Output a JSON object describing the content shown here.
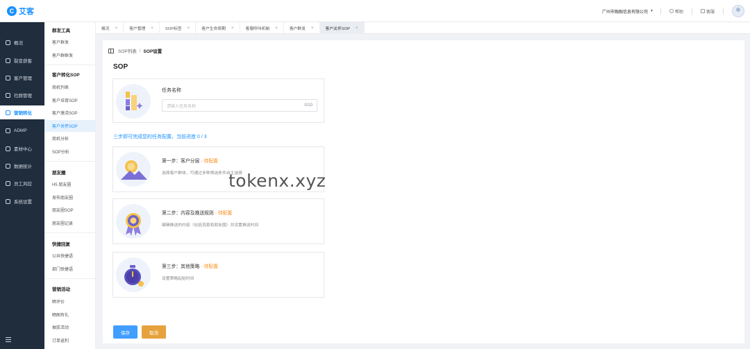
{
  "app": {
    "logo_mark": "C",
    "logo_text": "艾客"
  },
  "topbar": {
    "company": "广州市融融信息有限公司",
    "help": "帮助",
    "service": "客服"
  },
  "nav": {
    "items": [
      {
        "label": "概况",
        "icon": "home-icon"
      },
      {
        "label": "裂变获客",
        "icon": "user-icon"
      },
      {
        "label": "客户管理",
        "icon": "contacts-icon"
      },
      {
        "label": "社群管理",
        "icon": "group-icon"
      },
      {
        "label": "营销转化",
        "icon": "chart-icon",
        "active": true
      },
      {
        "label": "ADMP",
        "icon": "database-icon"
      },
      {
        "label": "素材中心",
        "icon": "folder-icon"
      },
      {
        "label": "数据统计",
        "icon": "stats-icon"
      },
      {
        "label": "员工风控",
        "icon": "shield-icon"
      },
      {
        "label": "系统设置",
        "icon": "gear-icon"
      }
    ]
  },
  "submenu": {
    "groups": [
      {
        "title": "群发工具",
        "items": [
          "客户群发",
          "客户群群发"
        ]
      },
      {
        "title": "客户转化SOP",
        "items": [
          "商机列表",
          "客户培育SOP",
          "客户激活SOP",
          "客户关怀SOP",
          "商机分析",
          "SOP分析"
        ]
      },
      {
        "title": "朋友圈",
        "items": [
          "H5 朋友圈",
          "发布朋友圈",
          "朋友圈SOP",
          "朋友圈记录"
        ]
      },
      {
        "title": "快捷回复",
        "items": [
          "公共快捷语",
          "部门快捷语"
        ]
      },
      {
        "title": "营销活动",
        "items": [
          "晒评价",
          "晒图有礼",
          "抽奖活动",
          "订单返利"
        ]
      }
    ],
    "active_item": "客户关怀SOP"
  },
  "tabs": [
    {
      "label": "概况"
    },
    {
      "label": "客户管理"
    },
    {
      "label": "SOP标签"
    },
    {
      "label": "客户生命周期"
    },
    {
      "label": "客服呼叫机制"
    },
    {
      "label": "客户群发"
    },
    {
      "label": "客户关怀SOP",
      "active": true
    }
  ],
  "breadcrumb": {
    "parent": "SOP列表",
    "separator": "/",
    "current": "SOP设置"
  },
  "page_title": "SOP",
  "task": {
    "label": "任务名称",
    "placeholder": "请输入任务名称",
    "counter": "0/10"
  },
  "progress_tip": "三步即可完成您的任务配置，当前进度 0 / 3",
  "steps": [
    {
      "title": "第一步：客户分层",
      "status": "- 待配置",
      "desc": "选择客户群体，可通过多种筛选条件自主选择"
    },
    {
      "title": "第二步：内容及推送规则",
      "status": "- 待配置",
      "desc": "编辑推送的内容（包括消息和朋友圈）并设置推送时间"
    },
    {
      "title": "第三步：其他策略",
      "status": "- 待配置",
      "desc": "设置策略起始时间"
    }
  ],
  "buttons": {
    "save": "保存",
    "cancel": "取消"
  },
  "watermark": "tokenx.xyz",
  "colors": {
    "primary": "#1890ff",
    "sidebar_bg": "#1f2d3d",
    "pending": "#fa8c16",
    "save": "#409eff",
    "cancel": "#e6a23c"
  }
}
